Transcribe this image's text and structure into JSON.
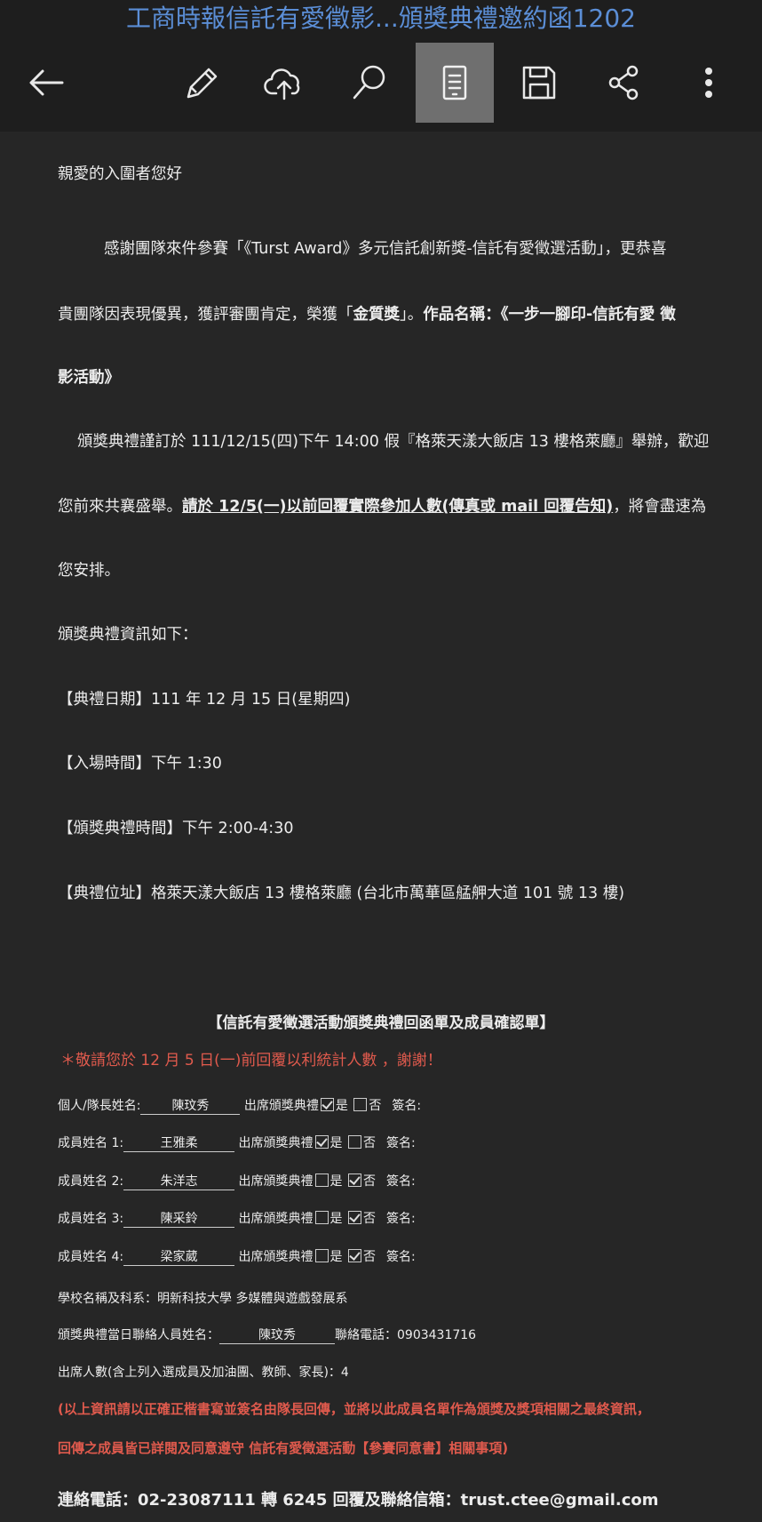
{
  "app": {
    "title": "工商時報信託有愛徵影...頒獎典禮邀約函1202"
  },
  "toolbar": {
    "back_icon": "arrow-left-icon",
    "edit_icon": "pencil-icon",
    "upload_icon": "cloud-upload-icon",
    "search_icon": "search-icon",
    "reading_view_icon": "document-view-icon",
    "save_icon": "floppy-disk-icon",
    "share_icon": "share-icon",
    "more_icon": "more-vertical-icon"
  },
  "letter": {
    "greeting": "親愛的入圍者您好",
    "p1_line1": "感謝團隊來件參賽「《Turst Award》多元信託創新獎-信託有愛徵選活動」，更恭喜",
    "p1_line2_a": "貴團隊因表現優異，獲評審團肯定，榮獲「",
    "p1_line2_award": "金質獎",
    "p1_line2_b": "」。",
    "p1_line2_work": "作品名稱：《一步一腳印-信託有愛 徵",
    "p1_line3": "影活動》",
    "p2_line1": "頒獎典禮謹訂於 111/12/15(四)下午 14:00 假『格萊天漾大飯店 13 樓格萊廳』舉辦，歡迎",
    "p2_line2_a": "您前來共襄盛舉。",
    "p2_line2_req": "請於 12/5(一)以前回覆實際參加人數(傳真或 mail 回覆告知)",
    "p2_line2_b": "，將會盡速為",
    "p2_line3": "您安排。",
    "info_heading": "頒獎典禮資訊如下：",
    "info_date": "【典禮日期】111 年 12 月 15 日(星期四)",
    "info_entry": "【入場時間】下午 1:30",
    "info_ceremony": "【頒獎典禮時間】下午 2:00-4:30",
    "info_venue": "【典禮位址】格萊天漾大飯店 13 樓格萊廳 (台北市萬華區艋舺大道 101 號 13 樓)"
  },
  "form": {
    "title": "【信託有愛徵選活動頒獎典禮回函單及成員確認單】",
    "note": "＊敬請您於 12 月 5 日(一)前回覆以利統計人數 ，謝謝！",
    "attend_label": "出席頒獎典禮",
    "yes_label": "是",
    "no_label": "否",
    "sign_label": "簽名:",
    "rows": [
      {
        "label": "個人/隊長姓名:",
        "name": "陳玟秀",
        "attend": true
      },
      {
        "label": "成員姓名 1:",
        "name": "王雅柔",
        "attend": true
      },
      {
        "label": "成員姓名 2:",
        "name": "朱洋志",
        "attend": false
      },
      {
        "label": "成員姓名 3:",
        "name": "陳采鈴",
        "attend": false
      },
      {
        "label": "成員姓名 4:",
        "name": "梁家葳",
        "attend": false
      }
    ],
    "school": "學校名稱及科系：明新科技大學 多媒體與遊戲發展系",
    "contact_person_label": "頒獎典禮當日聯絡人員姓名：",
    "contact_person_name": "陳玟秀",
    "contact_phone_label": "聯絡電話：0903431716",
    "attendance": "出席人數(含上列入選成員及加油團、教師、家長)：4",
    "warning_line1": "(以上資訊請以正確正楷書寫並簽名由隊長回傳，並將以此成員名單作為頒獎及獎項相關之最終資訊，",
    "warning_line2": "回傳之成員皆已詳閱及同意遵守 信託有愛徵選活動【參賽同意書】相關事項)",
    "contact_line": "連絡電話：02-23087111 轉 6245   回覆及聯絡信箱：trust.ctee@gmail.com"
  }
}
